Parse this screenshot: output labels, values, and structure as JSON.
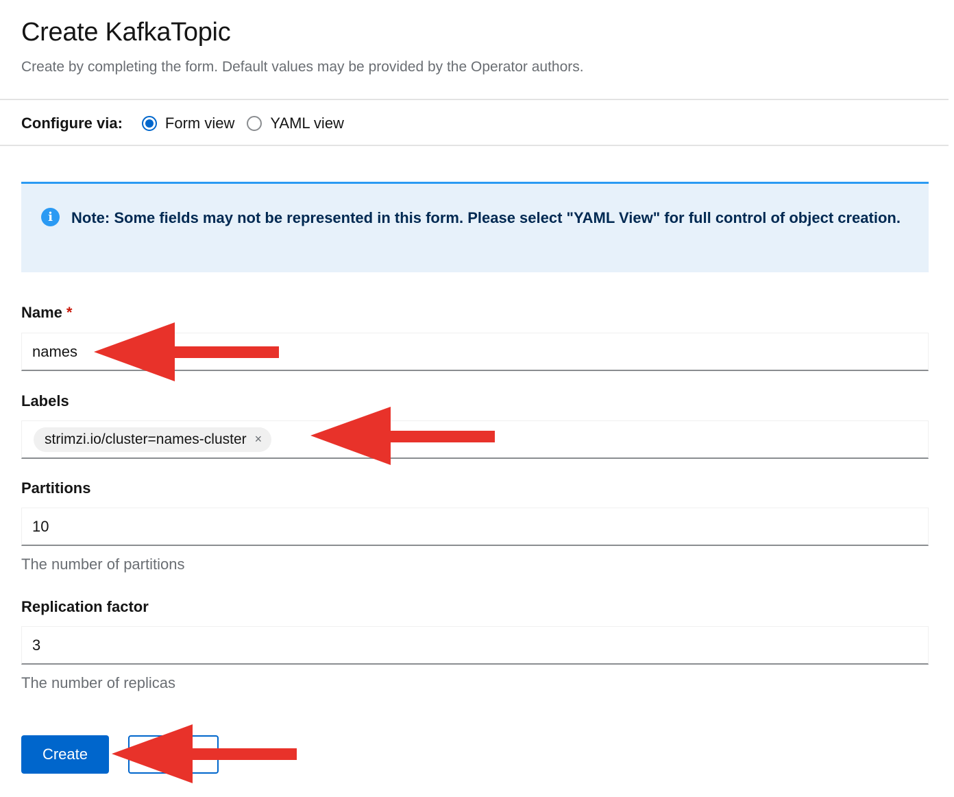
{
  "header": {
    "title": "Create KafkaTopic",
    "subtitle": "Create by completing the form. Default values may be provided by the Operator authors."
  },
  "configure": {
    "label": "Configure via:",
    "options": [
      {
        "label": "Form view",
        "selected": true
      },
      {
        "label": "YAML view",
        "selected": false
      }
    ]
  },
  "alert": {
    "icon": "info-icon",
    "text": "Note: Some fields may not be represented in this form. Please select \"YAML View\" for full control of object creation."
  },
  "form": {
    "name": {
      "label": "Name",
      "required_marker": "*",
      "value": "names"
    },
    "labels": {
      "label": "Labels",
      "chips": [
        {
          "text": "strimzi.io/cluster=names-cluster",
          "remove": "×"
        }
      ]
    },
    "partitions": {
      "label": "Partitions",
      "value": "10",
      "helper": "The number of partitions"
    },
    "replication": {
      "label": "Replication factor",
      "value": "3",
      "helper": "The number of replicas"
    }
  },
  "actions": {
    "create_label": "Create",
    "cancel_label": ""
  },
  "annotations": {
    "arrow_color": "#e8322a"
  }
}
